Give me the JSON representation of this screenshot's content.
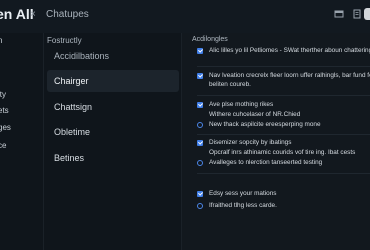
{
  "header": {
    "title": "en All",
    "close_glyph": "×",
    "subtitle": "Chatupes",
    "icons": [
      "window-icon",
      "document-icon",
      "avatar"
    ]
  },
  "sidebar": {
    "items": [
      "n",
      "l",
      "ity",
      "ets",
      "ges",
      "ce"
    ]
  },
  "middle": {
    "heading": "Fostructly",
    "items": [
      {
        "label": "Accidilbations",
        "active": false,
        "muted": true
      },
      {
        "label": "Chairger",
        "active": true,
        "muted": false
      },
      {
        "label": "Chattsign",
        "active": false,
        "muted": false
      },
      {
        "label": "Obletime",
        "active": false,
        "muted": false
      },
      {
        "label": "Betines",
        "active": false,
        "muted": false
      }
    ]
  },
  "right": {
    "heading": "Acdilongles",
    "options": [
      {
        "type": "checkbox",
        "checked": true,
        "text": "Alic lilles yo lil Petliomes - SWat therther aboun chattering"
      },
      {
        "type": "checkbox",
        "checked": true,
        "text": "Nav lveation crecrelx fleer loorn uffer ralhingls, bar fund feitan"
      },
      {
        "type": "text",
        "text": "beliten coureb."
      },
      {
        "type": "checkbox",
        "checked": true,
        "text": "Ave plse mothing rikes"
      },
      {
        "type": "text",
        "text": "Withere cuhcelaser of NR.Chied"
      },
      {
        "type": "radio",
        "checked": false,
        "text": "New thack aspilcite ereesperping mone"
      },
      {
        "type": "checkbox",
        "checked": true,
        "text": "Disemizer sopcity by ibatings"
      },
      {
        "type": "text",
        "text": "Opcralf inrs athinamic courids vof tire ing. Ibat cests"
      },
      {
        "type": "radio",
        "checked": false,
        "text": "Avalleges to nlerction tanseerted testing"
      },
      {
        "type": "checkbox",
        "checked": true,
        "text": "Edsy sess your mations"
      },
      {
        "type": "radio",
        "checked": false,
        "text": "Ifraithed tlhg less carde."
      }
    ]
  },
  "colors": {
    "accent": "#3f7ee8",
    "background": "#10161c"
  }
}
